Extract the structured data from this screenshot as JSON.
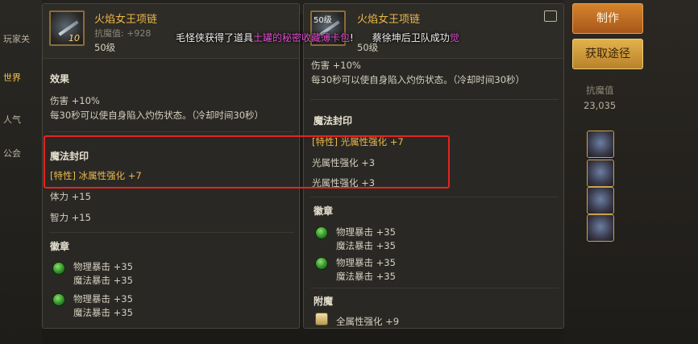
{
  "background": {
    "left_tabs": [
      "玩家关",
      "世界",
      "人气",
      "公会"
    ],
    "right_stat_label": "抗魔值",
    "right_stat_value": "23,035"
  },
  "left_panel": {
    "item_name": "火焰女王项链",
    "anti_magic": "抗魔值: +928",
    "level": "50级",
    "icon_badge": "10",
    "effect_title": "效果",
    "effect_lines": [
      "伤害 +10%",
      "每30秒可以使自身陷入灼伤状态。（冷却时间30秒）"
    ],
    "seal_title": "魔法封印",
    "seal_line": "[特性] 冰属性强化 +7",
    "extra_lines": [
      "体力 +15",
      "智力 +15"
    ],
    "emblem_title": "徽章",
    "emblems": [
      [
        "物理暴击 +35",
        "魔法暴击 +35"
      ],
      [
        "物理暴击 +35",
        "魔法暴击 +35"
      ]
    ]
  },
  "right_panel": {
    "item_name": "火焰女王项链",
    "icon_badge": "50级",
    "level": "50级",
    "effect_lines": [
      "伤害 +10%",
      "每30秒可以使自身陷入灼伤状态。（冷却时间30秒）"
    ],
    "seal_title": "魔法封印",
    "seal_lines": [
      "[特性] 光属性强化 +7",
      "光属性强化 +3",
      "光属性强化 +3"
    ],
    "emblem_title": "徽章",
    "emblems": [
      [
        "物理暴击 +35",
        "魔法暴击 +35"
      ],
      [
        "物理暴击 +35",
        "魔法暴击 +35"
      ]
    ],
    "enchant_title": "附魔",
    "enchant_line": "全属性强化 +9"
  },
  "buttons": {
    "craft": "制作",
    "acquire": "获取途径"
  },
  "notice": {
    "prefix": "毛怪侠获得了道具",
    "item": "土罐的秘密收藏薄卡包",
    "middle": "!",
    "suffix": "蔡徐坤后卫队成功",
    "end": "觉"
  },
  "colors": {
    "highlight": "#e5241f",
    "accent_button": "#c8701f",
    "item_name": "#e9b74a"
  }
}
